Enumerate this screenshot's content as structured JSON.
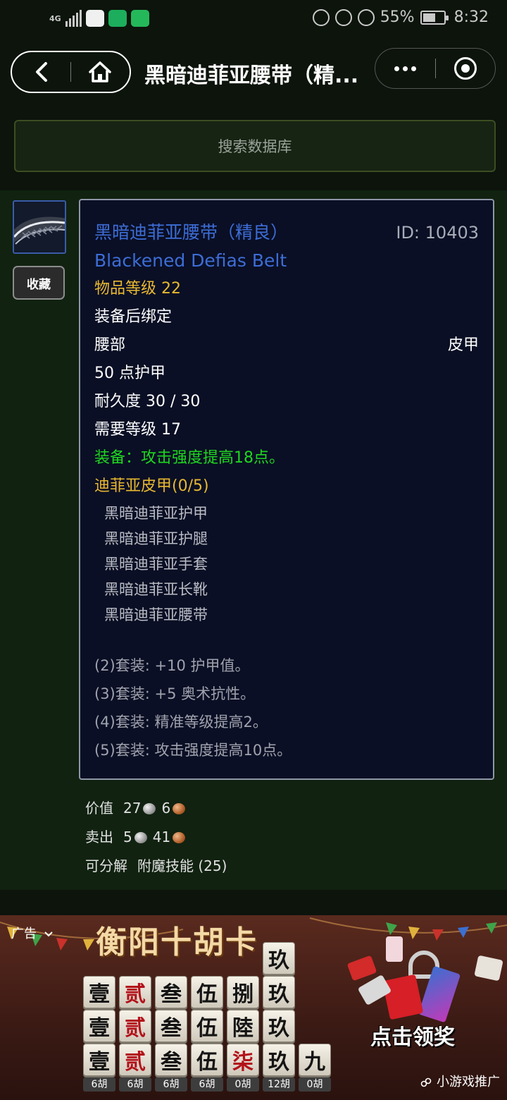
{
  "status_bar": {
    "network": "4G",
    "battery": "55%",
    "time": "8:32"
  },
  "nav": {
    "title": "黑暗迪菲亚腰带（精..."
  },
  "search": {
    "placeholder": "搜索数据库"
  },
  "item": {
    "favorite_label": "收藏",
    "name_cn": "黑暗迪菲亚腰带（精良）",
    "id_text": "ID: 10403",
    "name_en": "Blackened Defias Belt",
    "item_level": "物品等级 22",
    "binding": "装备后绑定",
    "slot": "腰部",
    "armor_type": "皮甲",
    "armor": "50 点护甲",
    "durability": "耐久度 30 / 30",
    "required_level": "需要等级 17",
    "equip_effect": "装备：攻击强度提高18点。",
    "set_name": "迪菲亚皮甲(0/5)",
    "set_pieces": [
      "黑暗迪菲亚护甲",
      "黑暗迪菲亚护腿",
      "黑暗迪菲亚手套",
      "黑暗迪菲亚长靴",
      "黑暗迪菲亚腰带"
    ],
    "set_bonuses": [
      "(2)套装: +10 护甲值。",
      "(3)套装: +5 奥术抗性。",
      "(4)套装: 精准等级提高2。",
      "(5)套装: 攻击强度提高10点。"
    ],
    "value_label": "价值",
    "value_silver": "27",
    "value_copper": "6",
    "sell_label": "卖出",
    "sell_silver": "5",
    "sell_copper": "41",
    "disenchant_label": "可分解",
    "disenchant_value": "附魔技能 (25)",
    "coin_colors": {
      "silver": "#b0b0b0",
      "copper": "#b3612b"
    }
  },
  "ad": {
    "label": "广告",
    "headline": "衡阳十胡卡",
    "cta": "点击领奖",
    "source": "小游戏推广",
    "tile_columns": [
      {
        "tiles": [
          "壹",
          "壹",
          "壹"
        ],
        "hu": "6胡",
        "color": "black"
      },
      {
        "tiles": [
          "贰",
          "贰",
          "贰"
        ],
        "hu": "6胡",
        "color": "red"
      },
      {
        "tiles": [
          "叁",
          "叁",
          "叁"
        ],
        "hu": "6胡",
        "color": "black"
      },
      {
        "tiles": [
          "伍",
          "伍",
          "伍"
        ],
        "hu": "6胡",
        "color": "black"
      },
      {
        "tiles": [
          "捌",
          "陸",
          "柒"
        ],
        "hu": "0胡",
        "color": "mixed"
      },
      {
        "tiles": [
          "玖",
          "玖",
          "玖",
          "玖"
        ],
        "hu": "12胡",
        "color": "black"
      },
      {
        "tiles": [
          "九"
        ],
        "hu": "0胡",
        "color": "black"
      }
    ]
  }
}
